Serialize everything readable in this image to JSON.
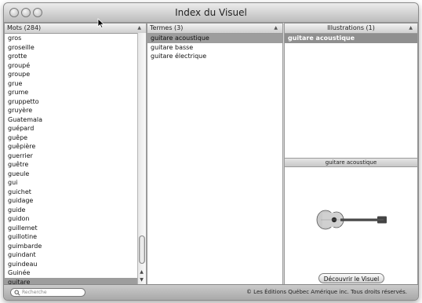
{
  "window": {
    "title": "Index du Visuel"
  },
  "words": {
    "header": "Mots (284)",
    "items": [
      "gros",
      "groseille",
      "grotte",
      "groupé",
      "groupe",
      "grue",
      "grume",
      "gruppetto",
      "gruyère",
      "Guatemala",
      "guépard",
      "guêpe",
      "guêpière",
      "guerrier",
      "guêtre",
      "gueule",
      "gui",
      "guichet",
      "guidage",
      "guide",
      "guidon",
      "guillemet",
      "guillotine",
      "guimbarde",
      "guindant",
      "guindeau",
      "Guinée",
      "guitare"
    ],
    "selected_index": 27
  },
  "terms": {
    "header": "Termes (3)",
    "items": [
      "guitare acoustique",
      "guitare basse",
      "guitare électrique"
    ],
    "selected_index": 0
  },
  "illustrations": {
    "header": "Illustrations (1)",
    "items": [
      "guitare acoustique"
    ],
    "selected_index": 0
  },
  "preview": {
    "title": "guitare acoustique",
    "button_label": "Découvrir le Visuel"
  },
  "bottom": {
    "search_placeholder": "Recherche",
    "copyright": "© Les Éditions Québec Amérique inc. Tous droits réservés."
  }
}
